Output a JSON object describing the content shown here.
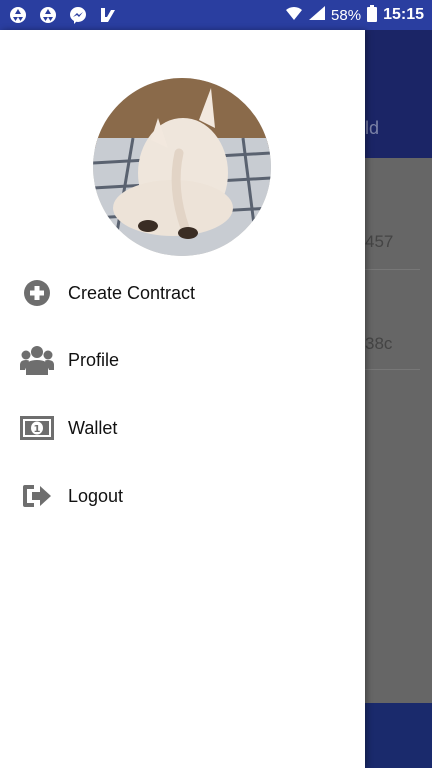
{
  "status_bar": {
    "battery": "58%",
    "time": "15:15"
  },
  "background_app": {
    "toolbar_text": "ld",
    "rows": [
      "457",
      "38c"
    ]
  },
  "drawer": {
    "menu": [
      {
        "label": "Create Contract",
        "icon": "plus-circle-icon"
      },
      {
        "label": "Profile",
        "icon": "users-icon"
      },
      {
        "label": "Wallet",
        "icon": "money-bill-icon"
      },
      {
        "label": "Logout",
        "icon": "sign-out-icon"
      }
    ]
  },
  "colors": {
    "status_bar": "#2a3ea0",
    "icon_gray": "#6e6e6e"
  }
}
